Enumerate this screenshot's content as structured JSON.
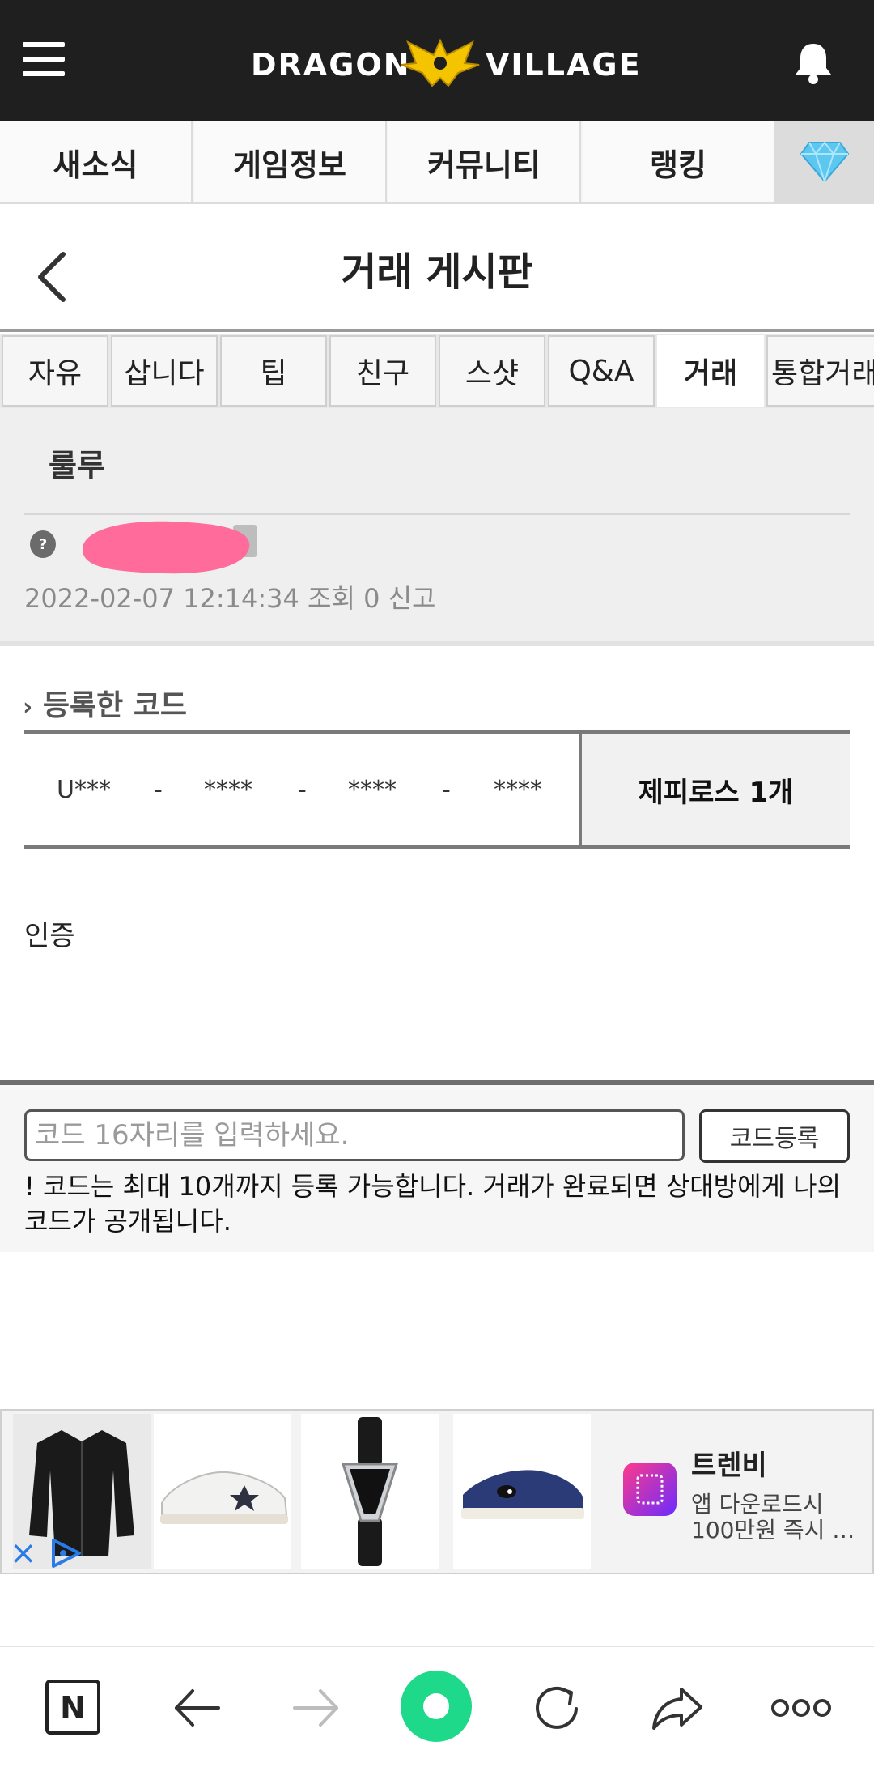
{
  "header": {
    "logo_left": "DRAGON",
    "logo_right": "VILLAGE"
  },
  "main_nav": {
    "items": [
      {
        "label": "새소식"
      },
      {
        "label": "게임정보"
      },
      {
        "label": "커뮤니티"
      },
      {
        "label": "랭킹"
      }
    ]
  },
  "page": {
    "title": "거래 게시판"
  },
  "sub_tabs": [
    {
      "label": "자유"
    },
    {
      "label": "삽니다"
    },
    {
      "label": "팁"
    },
    {
      "label": "친구"
    },
    {
      "label": "스샷"
    },
    {
      "label": "Q&A"
    },
    {
      "label": "거래",
      "active": true
    },
    {
      "label": "통합거래"
    }
  ],
  "post": {
    "title": "룰루",
    "meta": "2022-02-07 12:14:34  조회 0   신고"
  },
  "codes": {
    "section_label": "등록한 코드",
    "parts": [
      "U***",
      "-",
      "****",
      "-",
      "****",
      "-",
      "****"
    ],
    "item": "제피로스 1개"
  },
  "content": {
    "text": "인증"
  },
  "register": {
    "placeholder": "코드 16자리를 입력하세요.",
    "button_label": "코드등록",
    "notice": "! 코드는 최대 10개까지 등록 가능합니다. 거래가 완료되면 상대방에게 나의 코드가 공개됩니다."
  },
  "ad": {
    "brand": "트렌비",
    "line1": "앱 다운로드시",
    "line2": "100만원 즉시 …"
  },
  "colors": {
    "header_bg": "#1f1f1f",
    "logo_accent": "#f5c400",
    "diamond": "#5cc8f0",
    "center_button": "#1ed98a",
    "ad_close": "#2a7be6"
  }
}
